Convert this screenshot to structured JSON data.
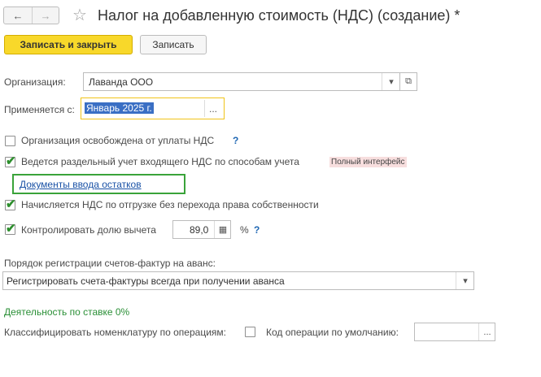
{
  "window": {
    "back_glyph": "←",
    "forward_glyph": "→",
    "favorite_glyph": "☆",
    "title": "Налог на добавленную стоимость (НДС) (создание) *"
  },
  "toolbar": {
    "save_close_label": "Записать и закрыть",
    "save_label": "Записать"
  },
  "organization": {
    "label": "Организация:",
    "value": "Лаванда ООО",
    "dropdown_glyph": "▾",
    "open_glyph": "⧉"
  },
  "applies_from": {
    "label": "Применяется с:",
    "value": "Январь 2025 г.",
    "select_glyph": "..."
  },
  "options": {
    "exempt": {
      "label": "Организация освобождена от уплаты НДС",
      "checked": false,
      "help": "?"
    },
    "separate": {
      "label": "Ведется раздельный учет входящего НДС по способам учета",
      "checked": true,
      "badge": "Полный интерфейс"
    },
    "docs_link": "Документы ввода остатков",
    "shipment": {
      "label": "Начисляется НДС по отгрузке без перехода права собственности",
      "checked": true
    },
    "control": {
      "label": "Контролировать долю вычета",
      "checked": true,
      "value": "89,0",
      "unit": "%",
      "help": "?",
      "calc_glyph": "▦"
    }
  },
  "invoice_order": {
    "label": "Порядок регистрации счетов-фактур на аванс:",
    "value": "Регистрировать счета-фактуры всегда при получении аванса",
    "dropdown_glyph": "▾"
  },
  "rate_section": {
    "heading": "Деятельность по ставке 0%",
    "classify_label": "Классифицировать номенклатуру по операциям:",
    "classify_checked": false,
    "op_code_label": "Код операции по умолчанию:",
    "op_code_value": "",
    "select_glyph": "..."
  },
  "colors": {
    "primary_button": "#f8d82a",
    "link": "#1a52a6",
    "section_heading": "#2a8f36",
    "selection_highlight": "#3a6fc4",
    "focus_border_yellow": "#f0c419",
    "focus_border_green": "#3aa33a"
  }
}
